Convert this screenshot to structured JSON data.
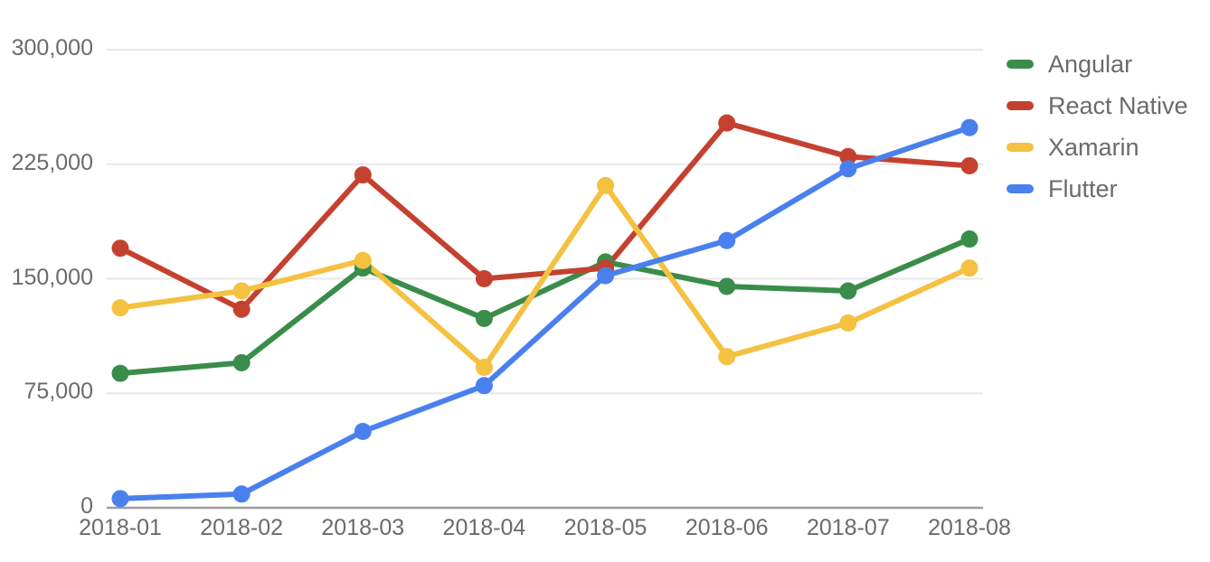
{
  "chart_data": {
    "type": "line",
    "title": "",
    "subtitle": "",
    "xlabel": "",
    "ylabel": "",
    "categories": [
      "2018-01",
      "2018-02",
      "2018-03",
      "2018-04",
      "2018-05",
      "2018-06",
      "2018-07",
      "2018-08"
    ],
    "ylim": [
      0,
      300000
    ],
    "y_ticks": [
      0,
      75000,
      150000,
      225000,
      300000
    ],
    "y_tick_labels": [
      "0",
      "75,000",
      "150,000",
      "225,000",
      "300,000"
    ],
    "grid": "horizontal",
    "legend_position": "right",
    "markers": true,
    "series": [
      {
        "name": "Angular",
        "color": "#3a8c4a",
        "values": [
          88000,
          95000,
          157000,
          124000,
          161000,
          145000,
          142000,
          176000
        ]
      },
      {
        "name": "React Native",
        "color": "#c5412f",
        "values": [
          170000,
          130000,
          218000,
          150000,
          157000,
          252000,
          230000,
          224000
        ]
      },
      {
        "name": "Xamarin",
        "color": "#f4c141",
        "values": [
          131000,
          142000,
          162000,
          92000,
          211000,
          99000,
          121000,
          157000
        ]
      },
      {
        "name": "Flutter",
        "color": "#4a80ee",
        "values": [
          6000,
          9000,
          50000,
          80000,
          152000,
          175000,
          222000,
          249000
        ]
      }
    ]
  },
  "legend": {
    "items": [
      {
        "label": "Angular",
        "color": "#3a8c4a"
      },
      {
        "label": "React Native",
        "color": "#c5412f"
      },
      {
        "label": "Xamarin",
        "color": "#f4c141"
      },
      {
        "label": "Flutter",
        "color": "#4a80ee"
      }
    ]
  },
  "axes": {
    "y_labels": [
      "300,000",
      "225,000",
      "150,000",
      "75,000",
      "0"
    ],
    "x_labels": [
      "2018-01",
      "2018-02",
      "2018-03",
      "2018-04",
      "2018-05",
      "2018-06",
      "2018-07",
      "2018-08"
    ]
  },
  "style": {
    "gridline_color": "#e8e8e8",
    "axis_color": "#9e9e9e",
    "tick_text_color": "#6b6b6b",
    "background": "#ffffff"
  }
}
